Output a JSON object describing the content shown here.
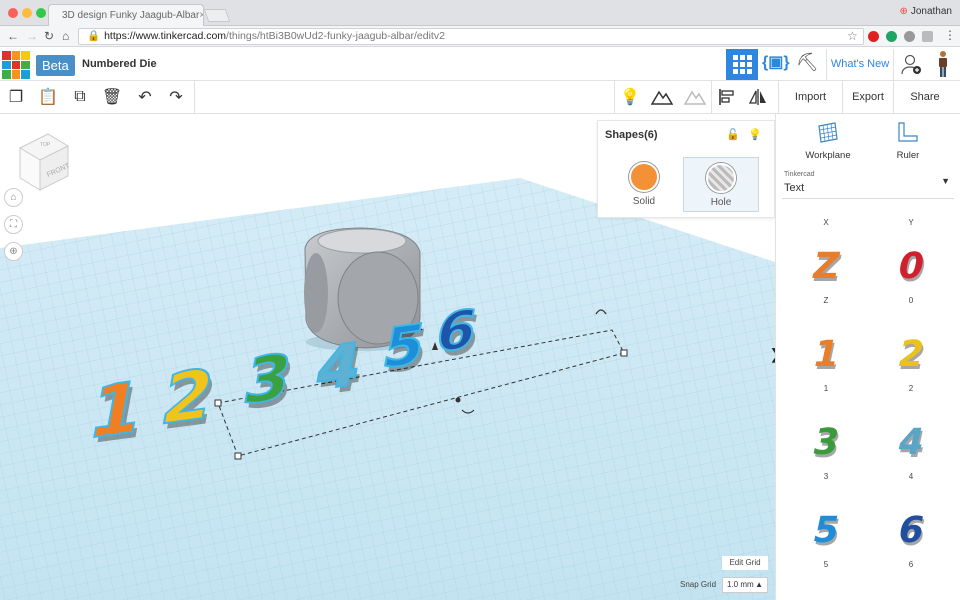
{
  "browser": {
    "tab_title": "3D design Funky Jaagub-Albar",
    "tab_close": "×",
    "user_name": "Jonathan",
    "url_scheme": "https://",
    "url_host": "www.tinkercad.com",
    "url_path": "/things/htBi3B0wUd2-funky-jaagub-albar/editv2"
  },
  "app": {
    "logo_letters": [
      "TIN",
      "KER",
      "CAD"
    ],
    "beta_label": "Beta",
    "design_title": "Numbered Die",
    "whats_new_label": "What's New"
  },
  "toolbar": {
    "import_label": "Import",
    "export_label": "Export",
    "share_label": "Share"
  },
  "viewcube": {
    "front_label": "FRONT",
    "top_label": "TOP"
  },
  "shapes_panel": {
    "title": "Shapes(6)",
    "solid_label": "Solid",
    "hole_label": "Hole",
    "solid_color": "#f39137"
  },
  "sidebar": {
    "workplane_label": "Workplane",
    "ruler_label": "Ruler",
    "category_group": "Tinkercad",
    "category_value": "Text",
    "items": [
      {
        "label": "X",
        "glyph": "",
        "color": ""
      },
      {
        "label": "Y",
        "glyph": "",
        "color": ""
      },
      {
        "label": "Z",
        "glyph": "Z",
        "color": "#e87d2a"
      },
      {
        "label": "0",
        "glyph": "0",
        "color": "#d0202e"
      },
      {
        "label": "1",
        "glyph": "1",
        "color": "#e87d2a"
      },
      {
        "label": "2",
        "glyph": "2",
        "color": "#e9c21b"
      },
      {
        "label": "3",
        "glyph": "3",
        "color": "#3a9b3a"
      },
      {
        "label": "4",
        "glyph": "4",
        "color": "#5aa5c6"
      },
      {
        "label": "5",
        "glyph": "5",
        "color": "#1f8ed6"
      },
      {
        "label": "6",
        "glyph": "6",
        "color": "#1f4f9e"
      }
    ]
  },
  "scene": {
    "digits": [
      {
        "text": "1",
        "color": "#ef7f22"
      },
      {
        "text": "2",
        "color": "#f2c31a"
      },
      {
        "text": "3",
        "color": "#3aa042"
      },
      {
        "text": "4",
        "color": "#5fb1d1"
      },
      {
        "text": "5",
        "color": "#1c8fd8"
      },
      {
        "text": "6",
        "color": "#1f55a8"
      }
    ]
  },
  "footer": {
    "edit_grid_label": "Edit Grid",
    "snap_grid_label": "Snap Grid",
    "snap_grid_value": "1.0 mm"
  }
}
